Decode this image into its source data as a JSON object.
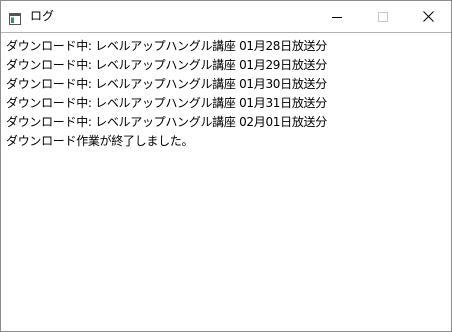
{
  "window": {
    "title": "ログ",
    "icon": "app-window-icon",
    "controls": {
      "minimize_icon": "minimize-icon",
      "maximize_icon": "maximize-icon",
      "close_icon": "close-icon"
    }
  },
  "log": {
    "lines": [
      "ダウンロード中: レベルアップハングル講座 01月28日放送分",
      "ダウンロード中: レベルアップハングル講座 01月29日放送分",
      "ダウンロード中: レベルアップハングル講座 01月30日放送分",
      "ダウンロード中: レベルアップハングル講座 01月31日放送分",
      "ダウンロード中: レベルアップハングル講座 02月01日放送分",
      "ダウンロード作業が終了しました。"
    ]
  },
  "colors": {
    "background": "#ffffff",
    "border": "#8c8c8c",
    "text": "#000000",
    "icon_accent": "#3c8c78"
  }
}
